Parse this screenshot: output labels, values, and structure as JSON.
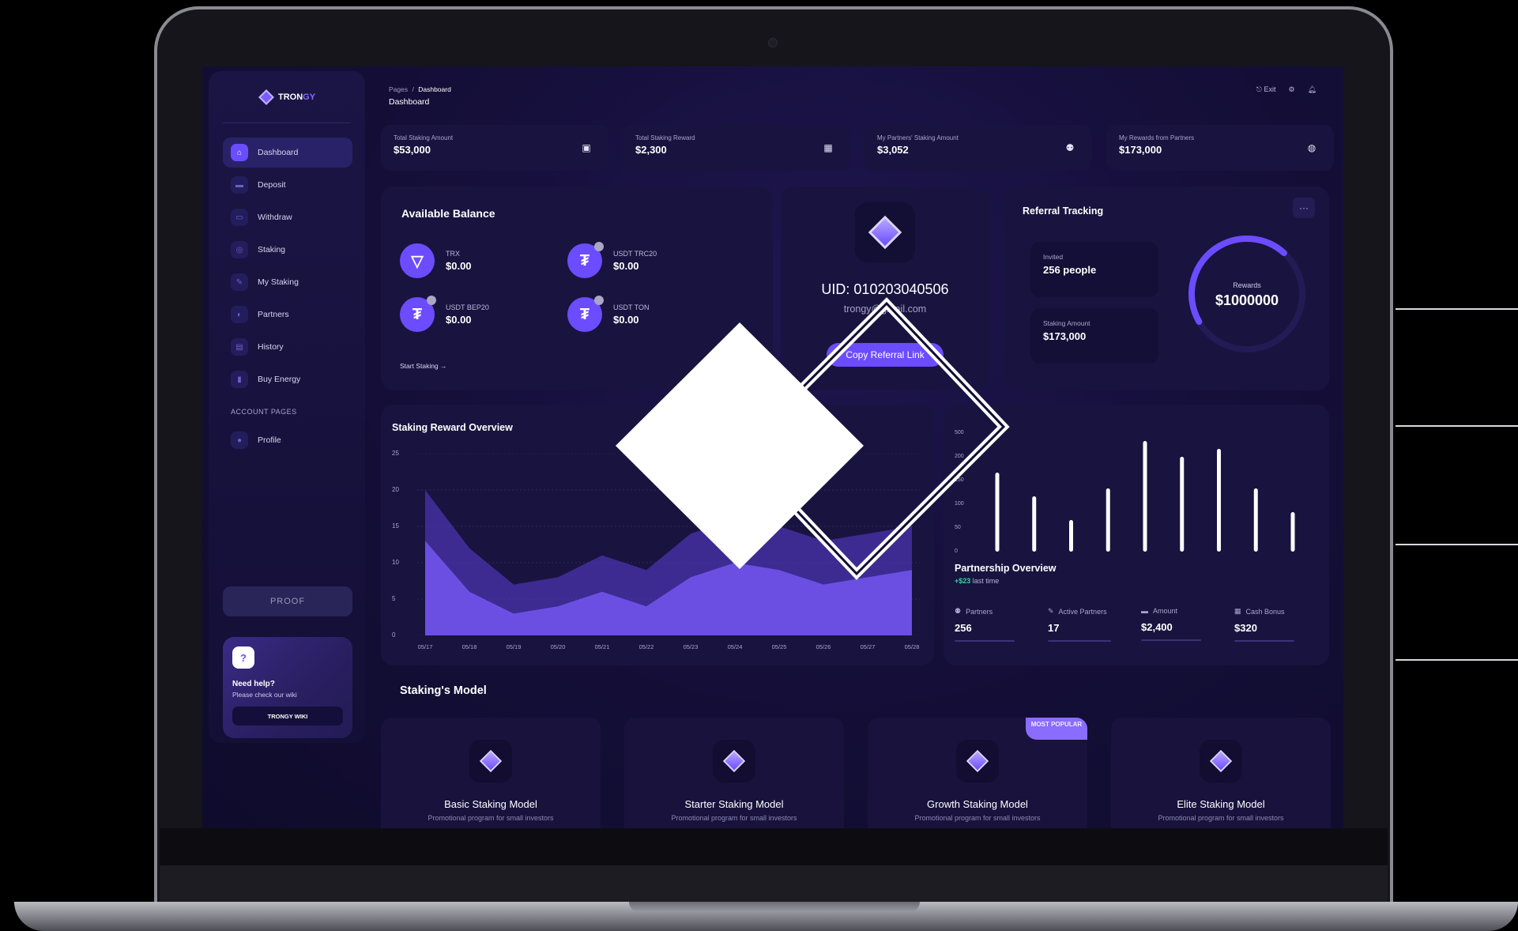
{
  "brand": {
    "name_part1": "TRON",
    "name_part2": "GY"
  },
  "sidebar": {
    "items": [
      {
        "label": "Dashboard",
        "icon": "home-icon",
        "active": true
      },
      {
        "label": "Deposit",
        "icon": "wallet-icon"
      },
      {
        "label": "Withdraw",
        "icon": "withdraw-icon"
      },
      {
        "label": "Staking",
        "icon": "staking-icon"
      },
      {
        "label": "My Staking",
        "icon": "pin-icon"
      },
      {
        "label": "Partners",
        "icon": "partners-icon"
      },
      {
        "label": "History",
        "icon": "history-icon"
      },
      {
        "label": "Buy Energy",
        "icon": "energy-icon"
      }
    ],
    "account_label": "ACCOUNT PAGES",
    "account_items": [
      {
        "label": "Profile",
        "icon": "user-icon"
      }
    ],
    "proof_label": "PROOF",
    "help": {
      "icon_text": "?",
      "title": "Need help?",
      "subtitle": "Please check our wiki",
      "button": "TRONGY WIKI"
    }
  },
  "header": {
    "breadcrumb_root": "Pages",
    "breadcrumb_sep": "/",
    "breadcrumb_current": "Dashboard",
    "title": "Dashboard",
    "exit_label": "Exit"
  },
  "stats": [
    {
      "label": "Total Staking Amount",
      "value": "$53,000",
      "icon": "wallet-icon"
    },
    {
      "label": "Total Staking Reward",
      "value": "$2,300",
      "icon": "money-icon"
    },
    {
      "label": "My Partners' Staking Amount",
      "value": "$3,052",
      "icon": "group-icon"
    },
    {
      "label": "My Rewards from Partners",
      "value": "$173,000",
      "icon": "reward-icon"
    }
  ],
  "balance": {
    "title": "Available Balance",
    "coins": [
      {
        "name": "TRX",
        "value": "$0.00"
      },
      {
        "name": "USDT TRC20",
        "value": "$0.00"
      },
      {
        "name": "USDT BEP20",
        "value": "$0.00"
      },
      {
        "name": "USDT TON",
        "value": "$0.00"
      }
    ],
    "start_link": "Start Staking →"
  },
  "uid_card": {
    "uid": "UID: 010203040506",
    "email": "trongy@gmail.com",
    "button": "Copy Referral Link"
  },
  "referral": {
    "title": "Referral Tracking",
    "more": "···",
    "invited_label": "Invited",
    "invited_value": "256 people",
    "staking_label": "Staking Amount",
    "staking_value": "$173,000",
    "rewards_label": "Rewards",
    "rewards_value": "$1000000",
    "gauge_fraction": 0.45
  },
  "staking_overview": {
    "title": "Staking Reward Overview",
    "yticks": [
      "25",
      "20",
      "15",
      "10",
      "5",
      "0"
    ],
    "xticks": [
      "05/17",
      "05/18",
      "05/19",
      "05/20",
      "05/21",
      "05/22",
      "05/23",
      "05/24",
      "05/25",
      "05/26",
      "05/27",
      "05/28"
    ]
  },
  "partnership": {
    "title": "Partnership Overview",
    "delta": "+$23",
    "delta_suffix": "last time",
    "yticks": [
      "500",
      "200",
      "150",
      "100",
      "50",
      "0"
    ],
    "stats": [
      {
        "label": "Partners",
        "value": "256",
        "icon": "partners-icon"
      },
      {
        "label": "Active Partners",
        "value": "17",
        "icon": "pin-icon"
      },
      {
        "label": "Amount",
        "value": "$2,400",
        "icon": "wallet-icon"
      },
      {
        "label": "Cash Bonus",
        "value": "$320",
        "icon": "money-icon"
      }
    ]
  },
  "models": {
    "title": "Staking's Model",
    "popular_badge": "MOST POPULAR",
    "items": [
      {
        "name": "Basic Staking Model",
        "desc": "Promotional program for small investors"
      },
      {
        "name": "Starter Staking Model",
        "desc": "Promotional program for small investors"
      },
      {
        "name": "Growth Staking Model",
        "desc": "Promotional program for small investors"
      },
      {
        "name": "Elite Staking Model",
        "desc": "Promotional program for small investors"
      }
    ]
  },
  "chart_data": [
    {
      "type": "area",
      "title": "Staking Reward Overview",
      "x": [
        "05/17",
        "05/18",
        "05/19",
        "05/20",
        "05/21",
        "05/22",
        "05/23",
        "05/24",
        "05/25",
        "05/26",
        "05/27",
        "05/28"
      ],
      "series": [
        {
          "values": [
            20,
            12,
            7,
            8,
            11,
            9,
            14,
            16,
            15,
            13,
            14,
            15
          ]
        },
        {
          "values": [
            13,
            6,
            3,
            4,
            6,
            4,
            8,
            10,
            9,
            7,
            8,
            9
          ]
        }
      ],
      "ylim": [
        0,
        25
      ],
      "colors": [
        "#5b3fd6",
        "#7b5cff"
      ]
    },
    {
      "type": "bar",
      "title": "Partnership Overview",
      "values": [
        5,
        3.5,
        2,
        4,
        7,
        6,
        6.5,
        4,
        2.5
      ],
      "ylim": [
        0,
        7.5
      ],
      "ytick_labels": [
        "0",
        "50",
        "100",
        "150",
        "200",
        "500"
      ]
    }
  ]
}
